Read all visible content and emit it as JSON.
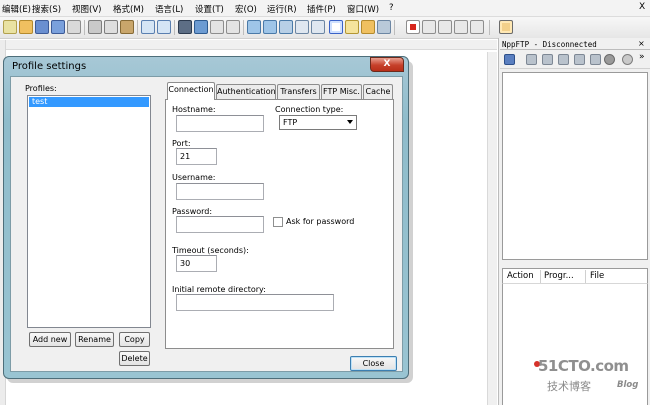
{
  "menu": {
    "items": [
      "编辑(E)",
      "搜索(S)",
      "视图(V)",
      "格式(M)",
      "语言(L)",
      "设置(T)",
      "宏(O)",
      "运行(R)",
      "插件(P)",
      "窗口(W)",
      "?"
    ],
    "close_label": "X"
  },
  "toolbar_icons": [
    "new-file-icon",
    "open-file-icon",
    "save-icon",
    "save-all-icon",
    "close-icon",
    "close-all-icon",
    "print-icon",
    "cut-icon",
    "copy-icon",
    "paste-icon",
    "undo-icon",
    "redo-icon",
    "find-icon",
    "replace-icon",
    "zoom-in-icon",
    "zoom-out-icon",
    "sync-v-icon",
    "sync-h-icon",
    "wrap-icon",
    "all-chars-icon",
    "indent-guide-icon",
    "lang-icon",
    "doc-map-icon",
    "macro-record-icon",
    "macro-stop-icon",
    "macro-play-icon",
    "macro-play-multi-icon",
    "macro-save-icon",
    "nppftp-icon"
  ],
  "ftp_panel": {
    "title": "NppFTP - Disconnected",
    "close": "×",
    "queue_columns": [
      "Action",
      "Progr...",
      "File"
    ]
  },
  "watermark": {
    "site": "51CTO.com",
    "tagline": "技术博客",
    "blog": "Blog"
  },
  "dialog": {
    "title": "Profile settings",
    "close": "X",
    "profiles_label": "Profiles:",
    "profiles": [
      "test"
    ],
    "buttons": {
      "add_new": "Add new",
      "rename": "Rename",
      "copy": "Copy",
      "delete": "Delete",
      "close": "Close"
    },
    "tabs": [
      "Connection",
      "Authentication",
      "Transfers",
      "FTP Misc.",
      "Cache"
    ],
    "connection": {
      "hostname_label": "Hostname:",
      "hostname": "",
      "connection_type_label": "Connection type:",
      "connection_type": "FTP",
      "port_label": "Port:",
      "port": "21",
      "username_label": "Username:",
      "username": "",
      "password_label": "Password:",
      "password": "",
      "ask_password_label": "Ask for password",
      "ask_password_checked": false,
      "timeout_label": "Timeout (seconds):",
      "timeout": "30",
      "initial_dir_label": "Initial remote directory:",
      "initial_dir": ""
    }
  },
  "colors": {
    "selection": "#3399ff",
    "dialog_frame": "#99c4d2",
    "close_red": "#c6402a"
  }
}
